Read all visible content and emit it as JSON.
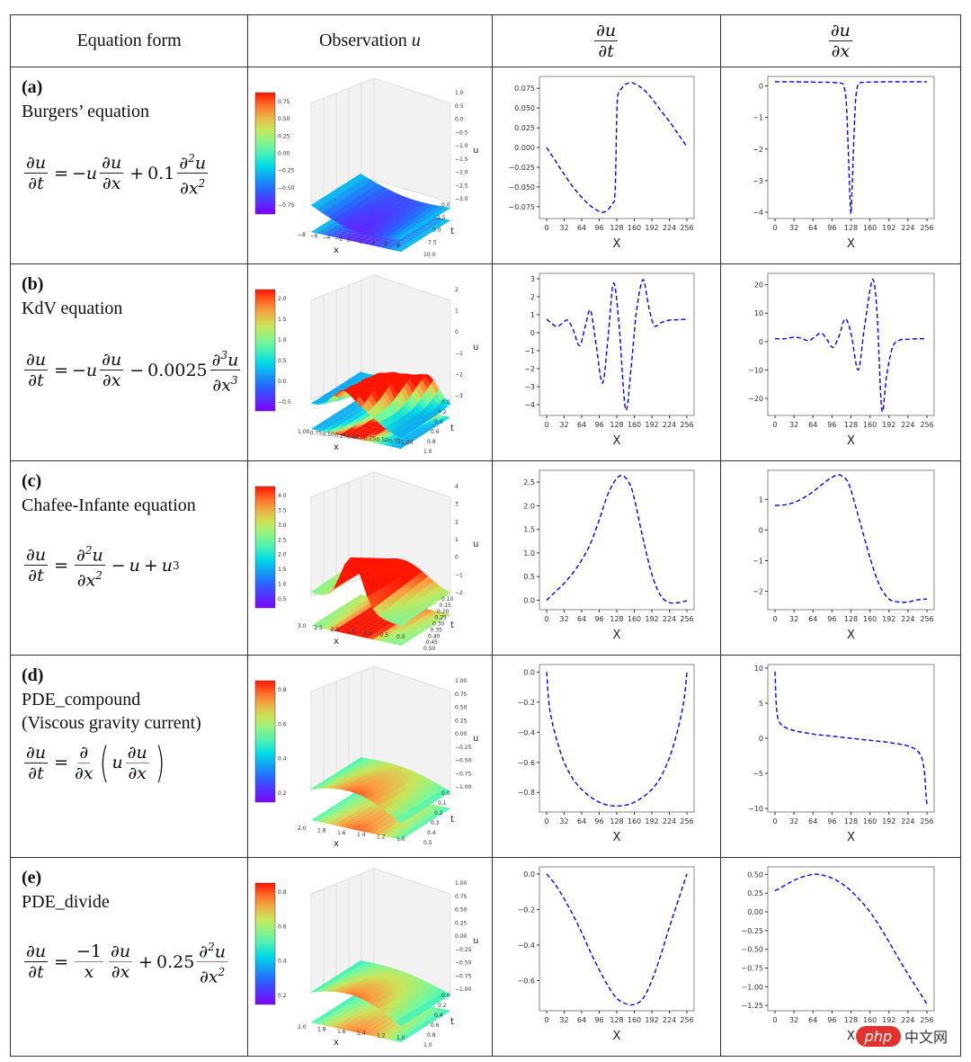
{
  "table": {
    "headers": {
      "equation_form": "Equation form",
      "observation": "Observation ",
      "observation_var": "u",
      "dudt_num": "∂u",
      "dudt_den": "∂t",
      "dudx_num": "∂u",
      "dudx_den": "∂x"
    },
    "rows": [
      {
        "label": "(a)",
        "name": "Burgers’ equation",
        "name2": "",
        "equation_text": "∂u/∂t = −u ∂u/∂x + 0.1 ∂²u/∂x²",
        "coef": "0.1"
      },
      {
        "label": "(b)",
        "name": "KdV equation",
        "name2": "",
        "equation_text": "∂u/∂t = −u ∂u/∂x − 0.0025 ∂³u/∂x³",
        "coef": "0.0025"
      },
      {
        "label": "(c)",
        "name": "Chafee-Infante equation",
        "name2": "",
        "equation_text": "∂u/∂t = ∂²u/∂x² − u + u³"
      },
      {
        "label": "(d)",
        "name": "PDE_compound",
        "name2": "(Viscous gravity current)",
        "equation_text": "∂u/∂t = ∂/∂x (u ∂u/∂x)"
      },
      {
        "label": "(e)",
        "name": "PDE_divide",
        "name2": "",
        "equation_text": "∂u/∂t = −1/x ∂u/∂x + 0.25 ∂²u/∂x²",
        "coef": "0.25"
      }
    ]
  },
  "surface_plots": [
    {
      "id": "a",
      "colorbar_ticks": [
        "0.75",
        "0.50",
        "0.25",
        "0.00",
        "−0.25",
        "−0.50",
        "−0.75"
      ],
      "z_ticks": [
        "1.0",
        "0.5",
        "0.0",
        "−0.5",
        "−1.0",
        "−1.5",
        "−2.0",
        "−2.5",
        "−3.0"
      ],
      "x_ticks": [
        "−8",
        "−6",
        "−4",
        "−2",
        "0",
        "2",
        "4",
        "6",
        "8"
      ],
      "t_ticks": [
        "0.0",
        "2.5",
        "5.0",
        "7.5",
        "10.0"
      ],
      "xlabel": "x",
      "tlabel": "t",
      "zlabel": "u"
    },
    {
      "id": "b",
      "colorbar_ticks": [
        "2.0",
        "1.5",
        "1.0",
        "0.5",
        "0.0",
        "−0.5"
      ],
      "z_ticks": [
        "2",
        "1",
        "0",
        "−1",
        "−2",
        "−3"
      ],
      "x_ticks": [
        "1.00",
        "0.75",
        "0.50",
        "0.25",
        "0.00",
        "−0.25",
        "−0.50",
        "−0.75",
        "−1.00"
      ],
      "t_ticks": [
        "0.0",
        "0.2",
        "0.4",
        "0.6",
        "0.8",
        "1.0"
      ],
      "xlabel": "x",
      "tlabel": "t",
      "zlabel": "u"
    },
    {
      "id": "c",
      "colorbar_ticks": [
        "4.0",
        "3.5",
        "3.0",
        "2.5",
        "2.0",
        "1.5",
        "1.0",
        "0.5"
      ],
      "z_ticks": [
        "4",
        "3",
        "2",
        "1",
        "0",
        "−1",
        "−2"
      ],
      "x_ticks": [
        "3.0",
        "2.5",
        "2.0",
        "1.5",
        "1.0",
        "0.5",
        "0.0"
      ],
      "t_ticks": [
        "0.10",
        "0.15",
        "0.20",
        "0.25",
        "0.30",
        "0.35",
        "0.40",
        "0.45",
        "0.50"
      ],
      "xlabel": "x",
      "tlabel": "t",
      "zlabel": "u"
    },
    {
      "id": "d",
      "colorbar_ticks": [
        "0.8",
        "0.6",
        "0.4",
        "0.2"
      ],
      "z_ticks": [
        "1.00",
        "0.75",
        "0.50",
        "0.25",
        "0.00",
        "−0.25",
        "−0.50",
        "−0.75",
        "−1.00"
      ],
      "x_ticks": [
        "2.0",
        "1.8",
        "1.6",
        "1.4",
        "1.2",
        "1.0"
      ],
      "t_ticks": [
        "0.0",
        "0.1",
        "0.2",
        "0.3",
        "0.4",
        "0.5"
      ],
      "xlabel": "x",
      "tlabel": "t",
      "zlabel": "u"
    },
    {
      "id": "e",
      "colorbar_ticks": [
        "0.8",
        "0.6",
        "0.4",
        "0.2"
      ],
      "z_ticks": [
        "1.00",
        "0.75",
        "0.50",
        "0.25",
        "0.00",
        "−0.25",
        "−0.50",
        "−0.75",
        "−1.00"
      ],
      "x_ticks": [
        "2.0",
        "1.8",
        "1.6",
        "1.4",
        "1.2",
        "1.0"
      ],
      "t_ticks": [
        "0.0",
        "0.2",
        "0.4",
        "0.6",
        "0.8",
        "1.0"
      ],
      "xlabel": "x",
      "tlabel": "t",
      "zlabel": "u"
    }
  ],
  "chart_data": [
    {
      "id": "a-dudt",
      "type": "line",
      "xlabel": "X",
      "ylabel": "",
      "xlim": [
        0,
        256
      ],
      "ylim": [
        -0.09,
        0.09
      ],
      "xticks": [
        0,
        32,
        64,
        96,
        128,
        160,
        192,
        224,
        256
      ],
      "yticks": [
        -0.075,
        -0.05,
        -0.025,
        0,
        0.025,
        0.05,
        0.075
      ],
      "ytick_labels": [
        "−0.075",
        "−0.050",
        "−0.025",
        "0.000",
        "0.025",
        "0.050",
        "0.075"
      ],
      "color": "#0000ff",
      "style": "dashed",
      "x": [
        0,
        16,
        32,
        48,
        64,
        80,
        96,
        104,
        112,
        120,
        124,
        126,
        128,
        130,
        136,
        144,
        152,
        160,
        176,
        192,
        208,
        224,
        240,
        256
      ],
      "y": [
        0,
        -0.017,
        -0.034,
        -0.05,
        -0.063,
        -0.074,
        -0.081,
        -0.082,
        -0.079,
        -0.071,
        -0.065,
        -0.03,
        0.04,
        0.066,
        0.074,
        0.08,
        0.082,
        0.081,
        0.074,
        0.062,
        0.047,
        0.033,
        0.017,
        0.001
      ]
    },
    {
      "id": "a-dudx",
      "type": "line",
      "xlabel": "X",
      "ylabel": "",
      "xlim": [
        0,
        256
      ],
      "ylim": [
        -4.2,
        0.3
      ],
      "xticks": [
        0,
        32,
        64,
        96,
        128,
        160,
        192,
        224,
        256
      ],
      "yticks": [
        -4,
        -3,
        -2,
        -1,
        0
      ],
      "ytick_labels": [
        "−4",
        "−3",
        "−2",
        "−1",
        "0"
      ],
      "color": "#0000ff",
      "style": "dashed",
      "x": [
        0,
        32,
        64,
        96,
        112,
        116,
        120,
        123,
        126,
        128,
        130,
        133,
        136,
        140,
        144,
        160,
        192,
        224,
        256
      ],
      "y": [
        0.13,
        0.13,
        0.12,
        0.11,
        0.08,
        0.0,
        -0.5,
        -1.8,
        -3.4,
        -4.05,
        -3.2,
        -1.6,
        -0.4,
        0.05,
        0.1,
        0.12,
        0.13,
        0.13,
        0.13
      ]
    },
    {
      "id": "b-dudt",
      "type": "line",
      "xlabel": "X",
      "ylabel": "",
      "xlim": [
        0,
        256
      ],
      "ylim": [
        -4.6,
        3.3
      ],
      "xticks": [
        0,
        32,
        64,
        96,
        128,
        160,
        192,
        224,
        256
      ],
      "yticks": [
        -4,
        -3,
        -2,
        -1,
        0,
        1,
        2,
        3
      ],
      "ytick_labels": [
        "−4",
        "−3",
        "−2",
        "−1",
        "0",
        "1",
        "2",
        "3"
      ],
      "color": "#0000ff",
      "style": "dashed",
      "x": [
        0,
        8,
        18,
        28,
        38,
        48,
        60,
        70,
        80,
        90,
        102,
        112,
        122,
        132,
        144,
        154,
        164,
        176,
        186,
        196,
        208,
        224,
        240,
        256
      ],
      "y": [
        0.75,
        0.55,
        0.35,
        0.5,
        0.7,
        0.2,
        -0.72,
        0.3,
        1.25,
        -0.6,
        -2.8,
        -0.3,
        2.75,
        0.5,
        -4.25,
        -2.0,
        1.2,
        2.95,
        1.5,
        0.4,
        0.55,
        0.7,
        0.72,
        0.75
      ]
    },
    {
      "id": "b-dudx",
      "type": "line",
      "xlabel": "X",
      "ylabel": "",
      "xlim": [
        0,
        256
      ],
      "ylim": [
        -26,
        24
      ],
      "xticks": [
        0,
        32,
        64,
        96,
        128,
        160,
        192,
        224,
        256
      ],
      "yticks": [
        -20,
        -10,
        0,
        10,
        20
      ],
      "ytick_labels": [
        "−20",
        "−10",
        "0",
        "10",
        "20"
      ],
      "color": "#0000ff",
      "style": "dashed",
      "x": [
        0,
        16,
        32,
        44,
        56,
        66,
        78,
        88,
        98,
        108,
        118,
        128,
        140,
        150,
        160,
        166,
        172,
        180,
        188,
        198,
        210,
        224,
        240,
        256
      ],
      "y": [
        1.0,
        1.0,
        1.5,
        1.2,
        0.3,
        1.5,
        3,
        0.5,
        -2,
        2,
        8,
        3,
        -10,
        4,
        18,
        21.5,
        10,
        -24,
        -12,
        -2,
        0.5,
        0.8,
        1.0,
        1.0
      ]
    },
    {
      "id": "c-dudt",
      "type": "line",
      "xlabel": "X",
      "ylabel": "",
      "xlim": [
        0,
        256
      ],
      "ylim": [
        -0.2,
        2.75
      ],
      "xticks": [
        0,
        32,
        64,
        96,
        128,
        160,
        192,
        224,
        256
      ],
      "yticks": [
        0,
        0.5,
        1.0,
        1.5,
        2.0,
        2.5
      ],
      "ytick_labels": [
        "0.0",
        "0.5",
        "1.0",
        "1.5",
        "2.0",
        "2.5"
      ],
      "color": "#0000ff",
      "style": "dashed",
      "x": [
        0,
        16,
        32,
        48,
        64,
        80,
        96,
        112,
        128,
        140,
        152,
        160,
        176,
        192,
        208,
        224,
        240,
        256
      ],
      "y": [
        0,
        0.18,
        0.36,
        0.58,
        0.85,
        1.2,
        1.7,
        2.25,
        2.58,
        2.63,
        2.45,
        2.15,
        1.3,
        0.55,
        0.1,
        -0.05,
        -0.05,
        -0.01
      ]
    },
    {
      "id": "c-dudx",
      "type": "line",
      "xlabel": "X",
      "ylabel": "",
      "xlim": [
        0,
        256
      ],
      "ylim": [
        -2.6,
        1.95
      ],
      "xticks": [
        0,
        32,
        64,
        96,
        128,
        160,
        192,
        224,
        256
      ],
      "yticks": [
        -2,
        -1,
        0,
        1
      ],
      "ytick_labels": [
        "−2",
        "−1",
        "0",
        "1"
      ],
      "color": "#0000ff",
      "style": "dashed",
      "x": [
        0,
        16,
        32,
        48,
        64,
        80,
        96,
        108,
        120,
        128,
        144,
        160,
        176,
        192,
        208,
        224,
        240,
        256
      ],
      "y": [
        0.8,
        0.82,
        0.9,
        1.05,
        1.25,
        1.5,
        1.72,
        1.8,
        1.65,
        1.3,
        0.2,
        -0.9,
        -1.8,
        -2.25,
        -2.35,
        -2.35,
        -2.28,
        -2.25
      ]
    },
    {
      "id": "d-dudt",
      "type": "line",
      "xlabel": "X",
      "ylabel": "",
      "xlim": [
        0,
        256
      ],
      "ylim": [
        -0.93,
        0.05
      ],
      "xticks": [
        0,
        32,
        64,
        96,
        128,
        160,
        192,
        224,
        256
      ],
      "yticks": [
        -0.8,
        -0.6,
        -0.4,
        -0.2,
        0
      ],
      "ytick_labels": [
        "−0.8",
        "−0.6",
        "−0.4",
        "−0.2",
        "0.0"
      ],
      "color": "#0000ff",
      "style": "dashed",
      "x": [
        0,
        4,
        10,
        20,
        32,
        48,
        64,
        80,
        96,
        112,
        128,
        144,
        160,
        176,
        192,
        208,
        224,
        236,
        246,
        252,
        256
      ],
      "y": [
        0,
        -0.2,
        -0.33,
        -0.47,
        -0.6,
        -0.71,
        -0.78,
        -0.83,
        -0.865,
        -0.885,
        -0.89,
        -0.885,
        -0.865,
        -0.83,
        -0.78,
        -0.7,
        -0.57,
        -0.43,
        -0.28,
        -0.15,
        0
      ]
    },
    {
      "id": "d-dudx",
      "type": "line",
      "xlabel": "X",
      "ylabel": "",
      "xlim": [
        0,
        256
      ],
      "ylim": [
        -10.5,
        10.5
      ],
      "xticks": [
        0,
        32,
        64,
        96,
        128,
        160,
        192,
        224,
        256
      ],
      "yticks": [
        -10,
        -5,
        0,
        5,
        10
      ],
      "ytick_labels": [
        "−10",
        "−5",
        "0",
        "5",
        "10"
      ],
      "color": "#0000ff",
      "style": "dashed",
      "x": [
        0,
        2,
        5,
        10,
        16,
        32,
        64,
        96,
        128,
        160,
        192,
        224,
        240,
        248,
        252,
        254,
        256
      ],
      "y": [
        9.5,
        5,
        2.8,
        2.0,
        1.6,
        1.1,
        0.6,
        0.3,
        0,
        -0.3,
        -0.6,
        -1.1,
        -1.8,
        -3,
        -5,
        -7.5,
        -9.5
      ]
    },
    {
      "id": "e-dudt",
      "type": "line",
      "xlabel": "X",
      "ylabel": "",
      "xlim": [
        0,
        256
      ],
      "ylim": [
        -0.77,
        0.04
      ],
      "xticks": [
        0,
        32,
        64,
        96,
        128,
        160,
        192,
        224,
        256
      ],
      "yticks": [
        -0.6,
        -0.4,
        -0.2,
        0
      ],
      "ytick_labels": [
        "−0.6",
        "−0.4",
        "−0.2",
        "0.0"
      ],
      "color": "#0000ff",
      "style": "dashed",
      "x": [
        0,
        16,
        32,
        48,
        64,
        80,
        96,
        112,
        128,
        144,
        160,
        176,
        192,
        208,
        224,
        240,
        256
      ],
      "y": [
        0,
        -0.06,
        -0.14,
        -0.23,
        -0.33,
        -0.44,
        -0.54,
        -0.63,
        -0.7,
        -0.73,
        -0.735,
        -0.7,
        -0.6,
        -0.46,
        -0.3,
        -0.15,
        0
      ]
    },
    {
      "id": "e-dudx",
      "type": "line",
      "xlabel": "X",
      "ylabel": "",
      "xlim": [
        0,
        256
      ],
      "ylim": [
        -1.32,
        0.6
      ],
      "xticks": [
        0,
        32,
        64,
        96,
        128,
        160,
        192,
        224,
        256
      ],
      "yticks": [
        -1.25,
        -1.0,
        -0.75,
        -0.5,
        -0.25,
        0,
        0.25,
        0.5
      ],
      "ytick_labels": [
        "−1.25",
        "−1.00",
        "−0.75",
        "−0.50",
        "−0.25",
        "0.00",
        "0.25",
        "0.50"
      ],
      "color": "#0000ff",
      "style": "dashed",
      "x": [
        0,
        16,
        32,
        48,
        64,
        72,
        80,
        96,
        112,
        128,
        144,
        160,
        176,
        192,
        208,
        224,
        240,
        256
      ],
      "y": [
        0.28,
        0.35,
        0.42,
        0.47,
        0.5,
        0.5,
        0.49,
        0.45,
        0.38,
        0.28,
        0.15,
        0.0,
        -0.19,
        -0.4,
        -0.62,
        -0.83,
        -1.03,
        -1.23
      ]
    }
  ],
  "watermark": {
    "pill": "php",
    "text": "中文网"
  }
}
